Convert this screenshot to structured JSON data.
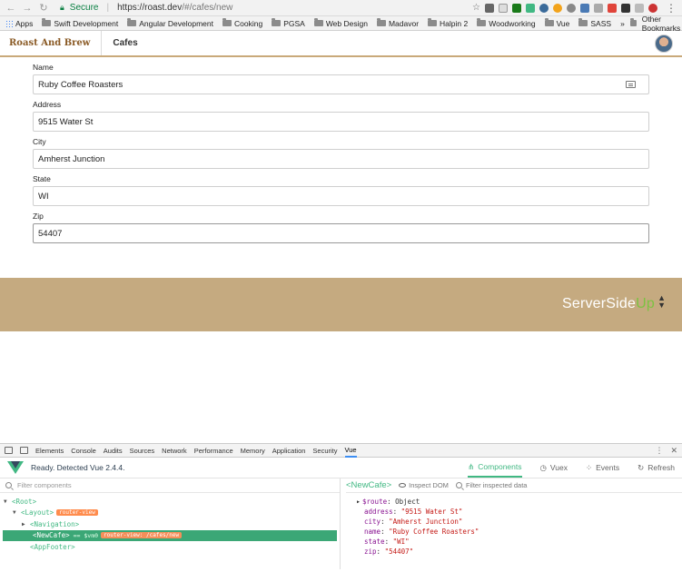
{
  "browser": {
    "secure_label": "Secure",
    "url_host": "https://roast.dev",
    "url_path": "/#/cafes/new",
    "bookmarks": [
      "Apps",
      "Swift Development",
      "Angular Development",
      "Cooking",
      "PGSA",
      "Web Design",
      "Madavor",
      "Halpin 2",
      "Woodworking",
      "Vue",
      "SASS"
    ],
    "other_bookmarks": "Other Bookmarks"
  },
  "app": {
    "brand": "Roast And Brew",
    "nav_cafes": "Cafes"
  },
  "form": {
    "name_label": "Name",
    "name_value": "Ruby Coffee Roasters",
    "address_label": "Address",
    "address_value": "9515 Water St",
    "city_label": "City",
    "city_value": "Amherst Junction",
    "state_label": "State",
    "state_value": "WI",
    "zip_label": "Zip",
    "zip_value": "54407"
  },
  "footer": {
    "brand_main": "ServerSide",
    "brand_accent": "Up"
  },
  "devtools": {
    "tabs": [
      "Elements",
      "Console",
      "Audits",
      "Sources",
      "Network",
      "Performance",
      "Memory",
      "Application",
      "Security",
      "Vue"
    ],
    "vue_status": "Ready. Detected Vue 2.4.4.",
    "vue_tabs": {
      "components": "Components",
      "vuex": "Vuex",
      "events": "Events",
      "refresh": "Refresh"
    },
    "filter_components": "Filter components",
    "tree": {
      "root": "<Root>",
      "layout": "<Layout>",
      "layout_badge": "router-view",
      "navigation": "<Navigation>",
      "newcafe": "<NewCafe>",
      "newcafe_vm": "== $vm0",
      "newcafe_badge": "router-view: /cafes/new",
      "appfooter": "<AppFooter>"
    },
    "inspector": {
      "component_name": "<NewCafe>",
      "inspect_dom": "Inspect DOM",
      "filter_data": "Filter inspected data",
      "route_key": "$route",
      "route_val": "Object",
      "address_key": "address",
      "address_val": "\"9515 Water St\"",
      "city_key": "city",
      "city_val": "\"Amherst Junction\"",
      "name_key": "name",
      "name_val": "\"Ruby Coffee Roasters\"",
      "state_key": "state",
      "state_val": "\"WI\"",
      "zip_key": "zip",
      "zip_val": "\"54407\""
    }
  }
}
